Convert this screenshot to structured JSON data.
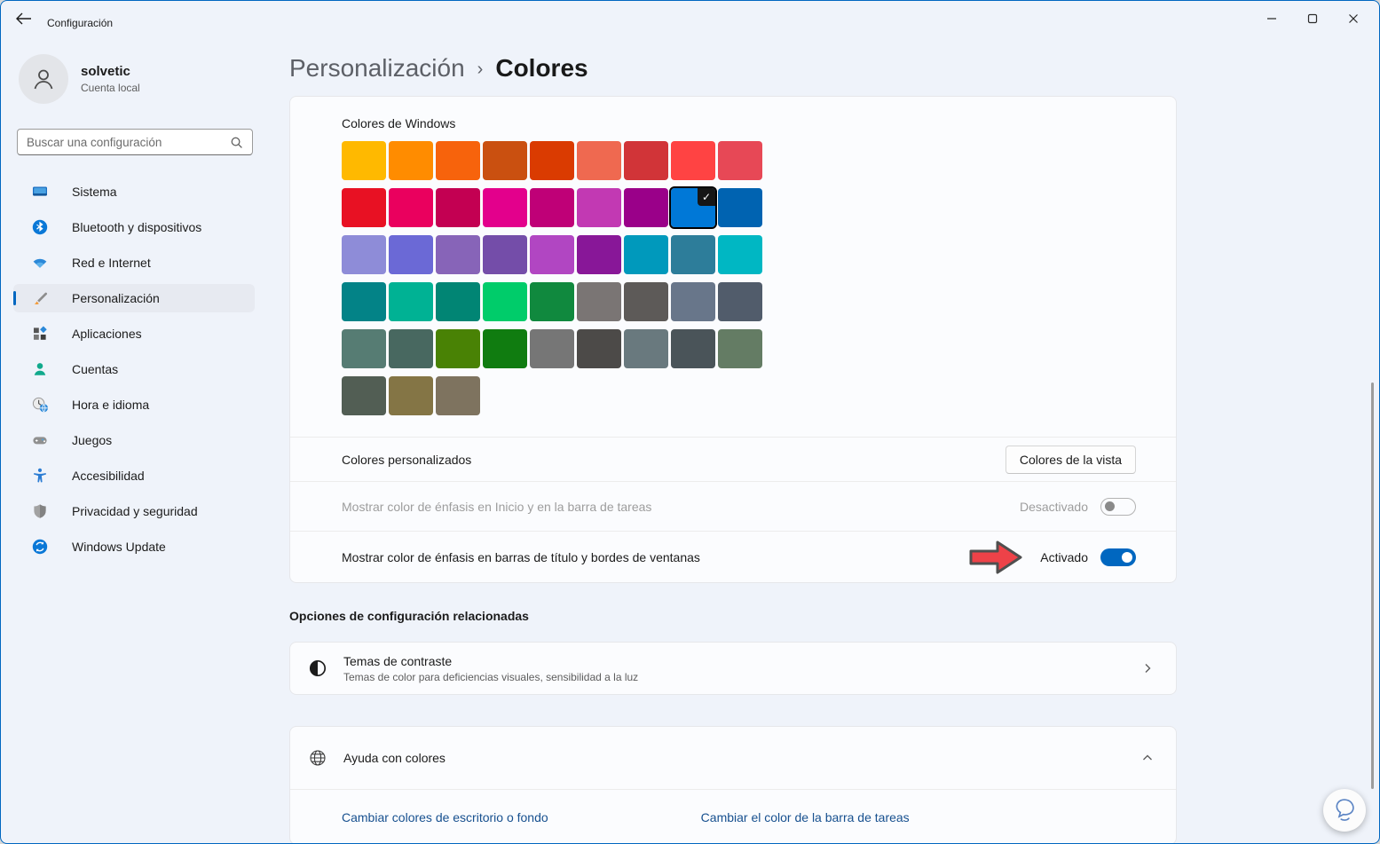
{
  "window": {
    "title": "Configuración",
    "controls": {
      "minimize": "minimize",
      "maximize": "maximize",
      "close": "close"
    }
  },
  "accent_color": "#0067c0",
  "profile": {
    "name": "solvetic",
    "account_type": "Cuenta local"
  },
  "search": {
    "placeholder": "Buscar una configuración"
  },
  "sidebar": {
    "items": [
      {
        "icon": "system",
        "label": "Sistema",
        "selected": false
      },
      {
        "icon": "bluetooth",
        "label": "Bluetooth y dispositivos",
        "selected": false
      },
      {
        "icon": "network",
        "label": "Red e Internet",
        "selected": false
      },
      {
        "icon": "personalization",
        "label": "Personalización",
        "selected": true
      },
      {
        "icon": "apps",
        "label": "Aplicaciones",
        "selected": false
      },
      {
        "icon": "accounts",
        "label": "Cuentas",
        "selected": false
      },
      {
        "icon": "time-language",
        "label": "Hora e idioma",
        "selected": false
      },
      {
        "icon": "gaming",
        "label": "Juegos",
        "selected": false
      },
      {
        "icon": "accessibility",
        "label": "Accesibilidad",
        "selected": false
      },
      {
        "icon": "privacy",
        "label": "Privacidad y seguridad",
        "selected": false
      },
      {
        "icon": "windows-update",
        "label": "Windows Update",
        "selected": false
      }
    ]
  },
  "breadcrumb": {
    "parent": "Personalización",
    "separator": "›",
    "current": "Colores"
  },
  "windows_colors": {
    "label": "Colores de Windows",
    "selected_index": 16,
    "selected_color": "#0078D7",
    "check_glyph": "✓",
    "colors": [
      "#FFB900",
      "#FF8C00",
      "#F7630C",
      "#CA5010",
      "#DA3B01",
      "#EF6950",
      "#D13438",
      "#FF4343",
      "#E74856",
      "#E81123",
      "#EA005E",
      "#C30052",
      "#E3008C",
      "#BF0077",
      "#C239B3",
      "#9A0089",
      "#0078D7",
      "#0063B1",
      "#8E8CD8",
      "#6B69D6",
      "#8764B8",
      "#744DA9",
      "#B146C2",
      "#881798",
      "#0099BC",
      "#2D7D9A",
      "#00B7C3",
      "#038387",
      "#00B294",
      "#018574",
      "#00CC6A",
      "#10893E",
      "#7A7574",
      "#5D5A58",
      "#68768A",
      "#515C6B",
      "#567C73",
      "#486860",
      "#498205",
      "#107C10",
      "#767676",
      "#4C4A48",
      "#69797E",
      "#4A5459",
      "#647C64",
      "#525E54",
      "#847545",
      "#7E735F"
    ]
  },
  "custom_colors": {
    "label": "Colores personalizados",
    "button_label": "Colores de la vista"
  },
  "toggles": {
    "accent_start_taskbar": {
      "label": "Mostrar color de énfasis en Inicio y en la barra de tareas",
      "state_label": "Desactivado",
      "on": false,
      "disabled": true
    },
    "accent_titlebars": {
      "label": "Mostrar color de énfasis en barras de título y bordes de ventanas",
      "state_label": "Activado",
      "on": true,
      "disabled": false
    }
  },
  "annotation": {
    "arrow_color": "#ee4248",
    "arrow_outline": "#4f4f4f"
  },
  "related": {
    "header": "Opciones de configuración relacionadas",
    "contrast_themes": {
      "title": "Temas de contraste",
      "subtitle": "Temas de color para deficiencias visuales, sensibilidad a la luz"
    }
  },
  "help_section": {
    "title": "Ayuda con colores",
    "expanded": true,
    "links": [
      "Cambiar colores de escritorio o fondo",
      "Cambiar el color de la barra de tareas"
    ]
  }
}
